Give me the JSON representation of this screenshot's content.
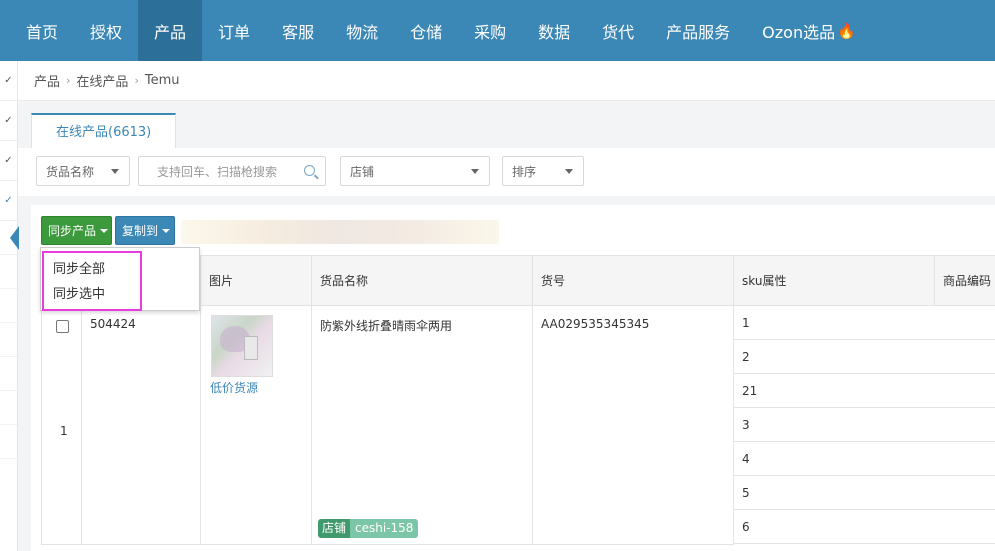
{
  "nav": {
    "items": [
      "首页",
      "授权",
      "产品",
      "订单",
      "客服",
      "物流",
      "仓储",
      "采购",
      "数据",
      "货代",
      "产品服务",
      "Ozon选品"
    ],
    "active": "产品",
    "hot_icon": "fire-icon"
  },
  "breadcrumb": [
    "产品",
    "在线产品",
    "Temu"
  ],
  "tab": {
    "label": "在线产品(6613)"
  },
  "filters": {
    "field_select": "货品名称",
    "search_placeholder": "支持回车、扫描枪搜索",
    "shop_select": "店铺",
    "sort_select": "排序"
  },
  "toolbar": {
    "sync_label": "同步产品",
    "copy_label": "复制到"
  },
  "dropdown": {
    "items": [
      "同步全部",
      "同步选中"
    ]
  },
  "table": {
    "headers": [
      "图片",
      "货品名称",
      "货号",
      "sku属性",
      "商品编码"
    ],
    "row": {
      "index": "1",
      "id": "504424",
      "image_link": "低价货源",
      "name": "防紫外线折叠晴雨伞两用",
      "item_no": "AA029535345345",
      "shop_tag_key": "店铺",
      "shop_tag_value": "ceshi-158",
      "skus": [
        "1",
        "2",
        "21",
        "3",
        "4",
        "5",
        "6"
      ]
    }
  },
  "colors": {
    "nav_bg": "#3b87b5",
    "nav_active": "#2c6f99",
    "sync_btn": "#3c9a3c",
    "copy_btn": "#3b87b5",
    "highlight": "#e83be0",
    "tag_key": "#419a6e",
    "tag_value": "#7cc6a8"
  }
}
